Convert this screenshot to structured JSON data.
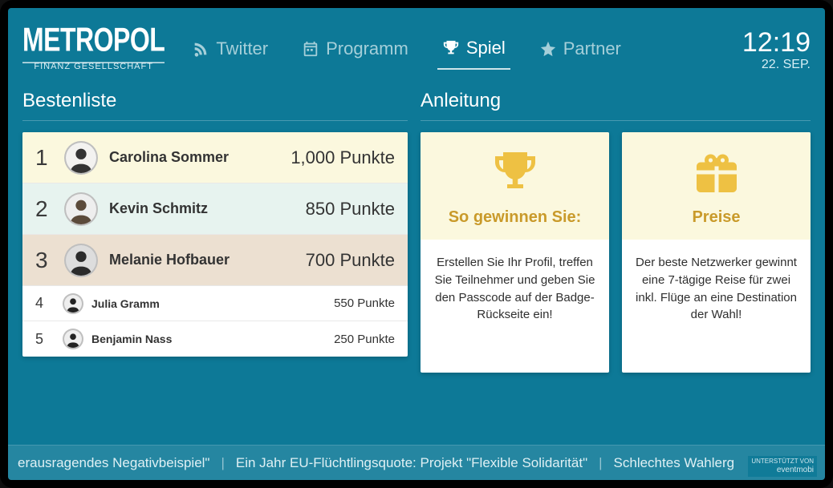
{
  "logo": {
    "main": "METROPOL",
    "sub": "FINANZ GESELLSCHAFT"
  },
  "nav": {
    "items": [
      {
        "label": "Twitter",
        "icon": "rss-icon",
        "active": false
      },
      {
        "label": "Programm",
        "icon": "calendar-icon",
        "active": false
      },
      {
        "label": "Spiel",
        "icon": "trophy-icon",
        "active": true
      },
      {
        "label": "Partner",
        "icon": "star-icon",
        "active": false
      }
    ]
  },
  "clock": {
    "time": "12:19",
    "date": "22. SEP."
  },
  "left": {
    "heading": "Bestenliste",
    "unit": "Punkte",
    "entries": [
      {
        "rank": "1",
        "name": "Carolina Sommer",
        "score": "1,000"
      },
      {
        "rank": "2",
        "name": "Kevin Schmitz",
        "score": "850"
      },
      {
        "rank": "3",
        "name": "Melanie Hofbauer",
        "score": "700"
      },
      {
        "rank": "4",
        "name": "Julia Gramm",
        "score": "550"
      },
      {
        "rank": "5",
        "name": "Benjamin Nass",
        "score": "250"
      }
    ]
  },
  "right": {
    "heading": "Anleitung",
    "cards": [
      {
        "icon": "trophy-icon",
        "title": "So gewinnen Sie:",
        "body": "Erstellen Sie Ihr Profil, treffen Sie Teilnehmer und geben Sie den Passcode auf der Badge-Rückseite ein!"
      },
      {
        "icon": "gift-icon",
        "title": "Preise",
        "body": "Der beste Netzwerker gewinnt eine 7-tägige Reise für zwei inkl. Flüge an eine Destination der Wahl!"
      }
    ]
  },
  "ticker": {
    "items": [
      "erausragendes Negativbeispiel\"",
      "Ein Jahr EU-Flüchtlingsquote: Projekt \"Flexible Solidarität\"",
      "Schlechtes Wahlerg"
    ]
  },
  "powered": {
    "label": "UNTERSTÜTZT VON",
    "brand": "eventmobi"
  }
}
